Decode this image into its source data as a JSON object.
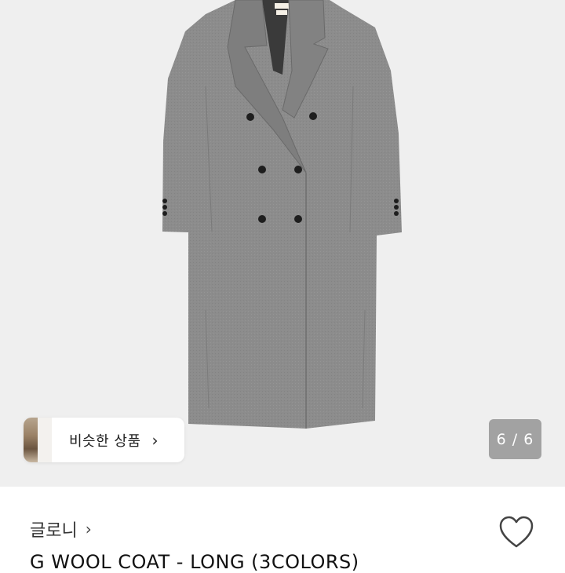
{
  "gallery": {
    "image_alt": "product-photo",
    "similar_label": "비슷한 상품",
    "similar_chevron": "›",
    "page_counter": "6 / 6"
  },
  "product": {
    "brand": "글로니",
    "brand_chevron": "›",
    "title": "G WOOL COAT - LONG (3COLORS)",
    "heart_icon": "heart-outline-icon"
  },
  "colors": {
    "hero_bg": "#efefef",
    "coat": "#8a8a8a",
    "counter_bg": "rgba(120,120,120,0.65)"
  }
}
